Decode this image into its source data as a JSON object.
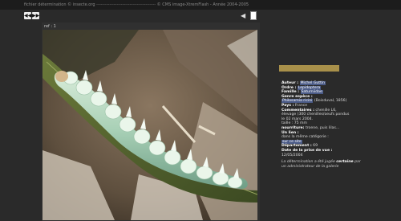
{
  "topbar": {
    "credit": "fichier détermination © insecte.org",
    "separator": "-----------------------------------------",
    "copyright": "© CMS image-XtremFlash - Année 2004-2005"
  },
  "nav": {
    "prev_label": "◀◀",
    "next_label": "▶▶",
    "back_label": "◀"
  },
  "photo": {
    "ref_label": "ref : 1"
  },
  "info": {
    "author_label": "Auteur :",
    "author_value": "Michel Guttin",
    "order_label": "Ordre :",
    "order_value": "Lepidoptera",
    "family_label": "Famille :",
    "family_value": "Saturniidae",
    "genus_label": "Genre espèce :",
    "genus_value": "Philosamia ricini",
    "genus_extra": "(Boisduval, 1856)",
    "country_label": "Pays :",
    "country_value": "France",
    "comments_label": "Commentaires :",
    "comments_line1": "chenille L6,",
    "comments_line2": "élevage (300 chenilles/oeufs pondus",
    "comments_line3": "le 02 mars 2004.",
    "comments_line4": "taille : 75 mm",
    "food_label": "nourriture:",
    "food_value": "troene, puis lilas...",
    "link_label": "Un lien :",
    "same_category": "dans la même catégorie :",
    "link_value": "sur ce site",
    "dept_label": "Département :",
    "dept_value": "69",
    "date_label": "Date de la prise de vue :",
    "date_value": "12/05/2004",
    "note_part1": "La détermination a été jugée",
    "note_bold": "certaine",
    "note_part2": "par un administrateur de la galerie"
  }
}
